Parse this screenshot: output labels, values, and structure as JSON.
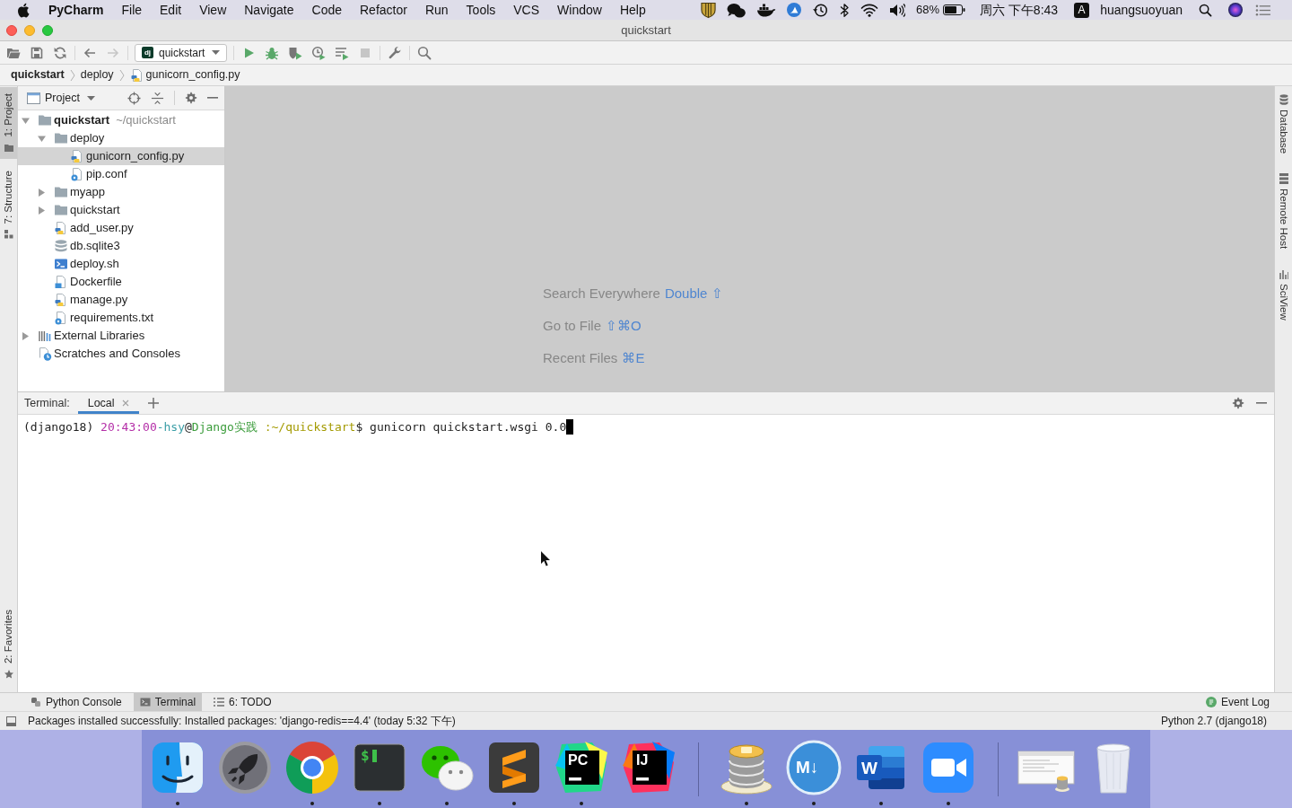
{
  "menu_bar": {
    "app_name": "PyCharm",
    "menus": [
      "File",
      "Edit",
      "View",
      "Navigate",
      "Code",
      "Refactor",
      "Run",
      "Tools",
      "VCS",
      "Window",
      "Help"
    ],
    "battery": "68%",
    "clock": "周六 下午8:43",
    "input_source": "A",
    "user": "huangsuoyuan"
  },
  "window": {
    "title": "quickstart"
  },
  "toolbar": {
    "groups": [
      [
        {
          "kind": "open",
          "disabled": false
        },
        {
          "kind": "save",
          "disabled": false
        },
        {
          "kind": "sync",
          "disabled": false
        }
      ],
      [
        {
          "kind": "back",
          "disabled": false
        },
        {
          "kind": "forward",
          "disabled": true
        }
      ],
      [
        {
          "kind": "run_config",
          "icon_text": "dj",
          "label": "quickstart",
          "disabled": false
        }
      ],
      [
        {
          "kind": "run",
          "disabled": false
        },
        {
          "kind": "debug",
          "disabled": false
        },
        {
          "kind": "coverage",
          "disabled": false
        },
        {
          "kind": "profile",
          "disabled": false
        },
        {
          "kind": "concurrency",
          "disabled": false
        },
        {
          "kind": "stop",
          "disabled": true
        }
      ],
      [
        {
          "kind": "settings",
          "disabled": false
        }
      ],
      [
        {
          "kind": "search",
          "disabled": false
        }
      ]
    ]
  },
  "breadcrumbs": [
    {
      "label": "quickstart",
      "kind": "project"
    },
    {
      "label": "deploy",
      "kind": "folder"
    },
    {
      "label": "gunicorn_config.py",
      "kind": "python"
    }
  ],
  "left_stripe": {
    "top": [
      {
        "label": "1: Project",
        "kind": "project",
        "selected": true
      },
      {
        "label": "7: Structure",
        "kind": "structure",
        "selected": false
      }
    ],
    "bottom": [
      {
        "label": "2: Favorites",
        "kind": "favorites",
        "selected": false
      }
    ]
  },
  "project_panel": {
    "title": "Project",
    "tree": [
      {
        "label": "quickstart",
        "hint": "~/quickstart",
        "kind": "project",
        "expanded": true,
        "selected": false,
        "children": [
          {
            "label": "deploy",
            "kind": "folder",
            "expanded": true,
            "selected": false,
            "children": [
              {
                "label": "gunicorn_config.py",
                "kind": "python",
                "selected": true
              },
              {
                "label": "pip.conf",
                "kind": "config",
                "selected": false
              }
            ]
          },
          {
            "label": "myapp",
            "kind": "folder",
            "expanded": false,
            "selected": false
          },
          {
            "label": "quickstart",
            "kind": "folder",
            "expanded": false,
            "selected": false
          },
          {
            "label": "add_user.py",
            "kind": "python",
            "selected": false
          },
          {
            "label": "db.sqlite3",
            "kind": "database",
            "selected": false
          },
          {
            "label": "deploy.sh",
            "kind": "shell",
            "selected": false
          },
          {
            "label": "Dockerfile",
            "kind": "docker",
            "selected": false
          },
          {
            "label": "manage.py",
            "kind": "python",
            "selected": false
          },
          {
            "label": "requirements.txt",
            "kind": "config",
            "selected": false
          }
        ]
      },
      {
        "label": "External Libraries",
        "kind": "libraries",
        "expanded": false,
        "selected": false
      },
      {
        "label": "Scratches and Consoles",
        "kind": "scratches",
        "selected": false
      }
    ]
  },
  "editor": {
    "hints": [
      {
        "label": "Search Everywhere",
        "shortcut": "Double ⇧"
      },
      {
        "label": "Go to File",
        "shortcut": "⇧⌘O"
      },
      {
        "label": "Recent Files",
        "shortcut": "⌘E"
      }
    ]
  },
  "right_stripe": [
    {
      "label": "Database",
      "kind": "database",
      "selected": false
    },
    {
      "label": "Remote Host",
      "kind": "remote_host",
      "selected": false
    },
    {
      "label": "SciView",
      "kind": "sciview",
      "selected": false
    }
  ],
  "terminal": {
    "title": "Terminal:",
    "tabs": [
      {
        "label": "Local",
        "selected": true
      }
    ],
    "prompt": [
      {
        "text": "(django18) "
      },
      {
        "text": "20:43:00",
        "color": "#b42fa8"
      },
      {
        "text": "-hsy",
        "color": "#3a9ea6"
      },
      {
        "text": "@"
      },
      {
        "text": "Django实践",
        "color": "#3b9c3b"
      },
      {
        "text": " :~/quickstart",
        "color": "#a39a00"
      },
      {
        "text": "$ gunicorn quickstart.wsgi 0.0"
      }
    ]
  },
  "tool_window_bar": {
    "left": [
      {
        "label": "Python Console",
        "kind": "console",
        "selected": false
      },
      {
        "label": "Terminal",
        "kind": "terminal",
        "selected": true
      },
      {
        "label": "6: TODO",
        "kind": "todo",
        "selected": false
      }
    ],
    "right": [
      {
        "label": "Event Log",
        "kind": "event_log",
        "selected": false
      }
    ]
  },
  "status_bar": {
    "message": "Packages installed successfully: Installed packages: 'django-redis==4.4' (today 5:32 下午)",
    "interpreter": "Python 2.7 (django18)"
  },
  "dock": {
    "groups": [
      [
        {
          "kind": "face",
          "running": true
        },
        {
          "kind": "rocket",
          "running": false
        },
        {
          "kind": "ring",
          "running": true
        },
        {
          "kind": "terminal",
          "label": "$",
          "running": true
        },
        {
          "kind": "chat",
          "running": true
        },
        {
          "kind": "s_logo",
          "running": true
        },
        {
          "kind": "pc_logo",
          "label": "PC",
          "running": true
        },
        {
          "kind": "ij_logo",
          "label": "IJ",
          "running": false
        }
      ],
      [
        {
          "kind": "database",
          "running": true
        },
        {
          "kind": "markdown",
          "label": "M↓",
          "running": true
        },
        {
          "kind": "document",
          "label": "W",
          "running": true
        },
        {
          "kind": "video",
          "running": true
        }
      ],
      [
        {
          "kind": "thumbnail",
          "running": false
        },
        {
          "kind": "trash",
          "running": false
        }
      ]
    ]
  }
}
